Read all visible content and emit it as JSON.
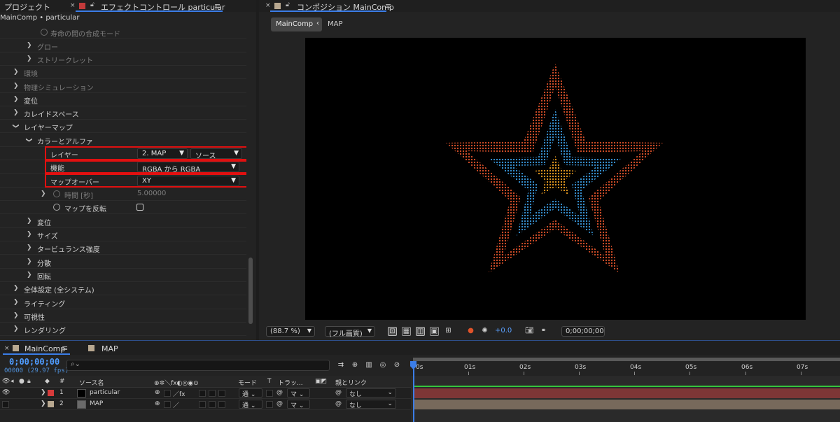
{
  "left_panel": {
    "tab_project": "プロジェクト",
    "tab_effect_controls": "エフェクトコントロール particular",
    "subtitle": "MainComp • particular",
    "rows": [
      {
        "label": "寿命の間の合成モード",
        "dim": true
      },
      {
        "label": "グロー",
        "dim": true
      },
      {
        "label": "ストリークレット",
        "dim": true
      },
      {
        "label": "環境",
        "dim": true
      },
      {
        "label": "物理シミュレーション",
        "dim": true
      },
      {
        "label": "変位"
      },
      {
        "label": "カレイドスペース"
      },
      {
        "label": "レイヤーマップ"
      },
      {
        "label": "カラーとアルファ"
      },
      {
        "label": "レイヤー"
      },
      {
        "label": "機能"
      },
      {
        "label": "マップオーバー"
      },
      {
        "label": "時間 [秒]",
        "dim": true
      },
      {
        "label": "マップを反転"
      },
      {
        "label": "変位"
      },
      {
        "label": "サイズ"
      },
      {
        "label": "タービュランス強度"
      },
      {
        "label": "分散"
      },
      {
        "label": "回転"
      },
      {
        "label": "全体設定 (全システム)"
      },
      {
        "label": "ライティング"
      },
      {
        "label": "可視性"
      },
      {
        "label": "レンダリング"
      }
    ],
    "layer_select": "2. MAP",
    "layer_source_select": "ソース",
    "function_select": "RGBA から RGBA",
    "map_over_select": "XY",
    "time_value": "5.00000"
  },
  "composition": {
    "tab_label": "コンポジション MainComp",
    "breadcrumb_active": "MainComp",
    "breadcrumb_other": "MAP",
    "zoom": "(88.7 %)",
    "resolution": "(フル画質)",
    "exposure": "+0.0",
    "timecode": "0;00;00;00"
  },
  "timeline": {
    "tab_main": "MainComp",
    "tab_map": "MAP",
    "timecode": "0;00;00;00",
    "frame_info": "00000 (29.97 fps)",
    "ruler": [
      "0s",
      "01s",
      "02s",
      "03s",
      "04s",
      "05s",
      "06s",
      "07s"
    ],
    "col_source": "ソース名",
    "col_mode": "モード",
    "col_t": "T",
    "col_track": "トラッ...",
    "col_parent": "親とリンク",
    "col_number": "#",
    "layers": [
      {
        "num": "1",
        "name": "particular",
        "mode": "通",
        "track": "マ",
        "parent": "なし",
        "color": "#d63b3b",
        "bar": "#7d3636"
      },
      {
        "num": "2",
        "name": "MAP",
        "mode": "通",
        "track": "マ",
        "parent": "なし",
        "color": "#b8a890",
        "bar": "#77695b"
      }
    ]
  },
  "colors": {
    "accent": "#3b7de8",
    "highlight_box": "#e11010",
    "star_outer": "#e0532a",
    "star_middle": "#3a9be0",
    "star_inner": "#f0a020"
  }
}
